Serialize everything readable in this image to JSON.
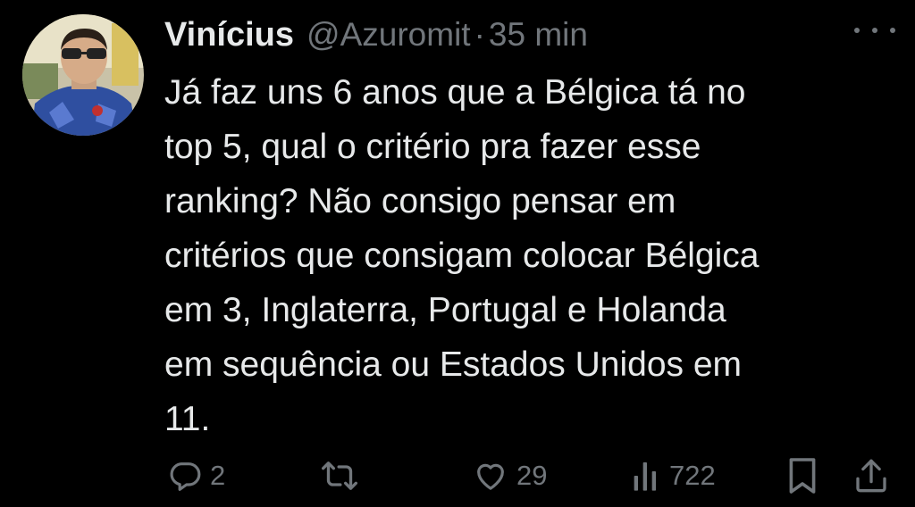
{
  "tweet": {
    "author_name": "Vinícius",
    "handle": "@Azuromit",
    "separator": "·",
    "time": "35 min",
    "text_lines": [
      "Já faz uns 6 anos que a Bélgica tá no",
      "top 5, qual o critério pra fazer esse",
      "ranking? Não consigo pensar em",
      "critérios que consigam colocar Bélgica",
      "em 3, Inglaterra, Portugal e Holanda",
      "em sequência ou Estados Unidos em",
      "11."
    ]
  },
  "actions": {
    "reply_count": "2",
    "retweet_count": "",
    "like_count": "29",
    "views_count": "722"
  },
  "icons": {
    "reply": "reply-icon",
    "retweet": "retweet-icon",
    "like": "heart-icon",
    "views": "views-icon",
    "bookmark": "bookmark-icon",
    "share": "share-icon",
    "more": "more-icon"
  },
  "colors": {
    "background": "#000000",
    "text": "#e7e9ea",
    "secondary": "#71767b"
  }
}
